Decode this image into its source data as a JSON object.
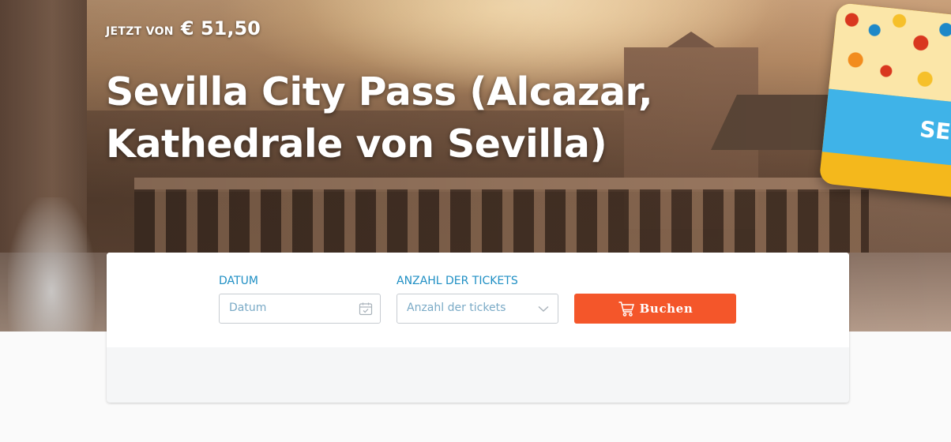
{
  "hero": {
    "price_prefix": "JETZT VON",
    "price_value": "€ 51,50",
    "title": "Sevilla City Pass (Alcazar, Kathedrale von Sevilla)",
    "pass_card_text": "SE"
  },
  "booking": {
    "date": {
      "label": "DATUM",
      "placeholder": "Datum",
      "icon": "calendar-icon"
    },
    "tickets": {
      "label": "ANZAHL DER TICKETS",
      "placeholder": "Anzahl der tickets",
      "icon": "chevron-down-icon"
    },
    "book_button": {
      "label": "Buchen",
      "icon": "cart-icon"
    }
  },
  "colors": {
    "accent_button": "#f4562a",
    "label_blue": "#1f8fc4",
    "placeholder_blue": "#7aaac6"
  }
}
